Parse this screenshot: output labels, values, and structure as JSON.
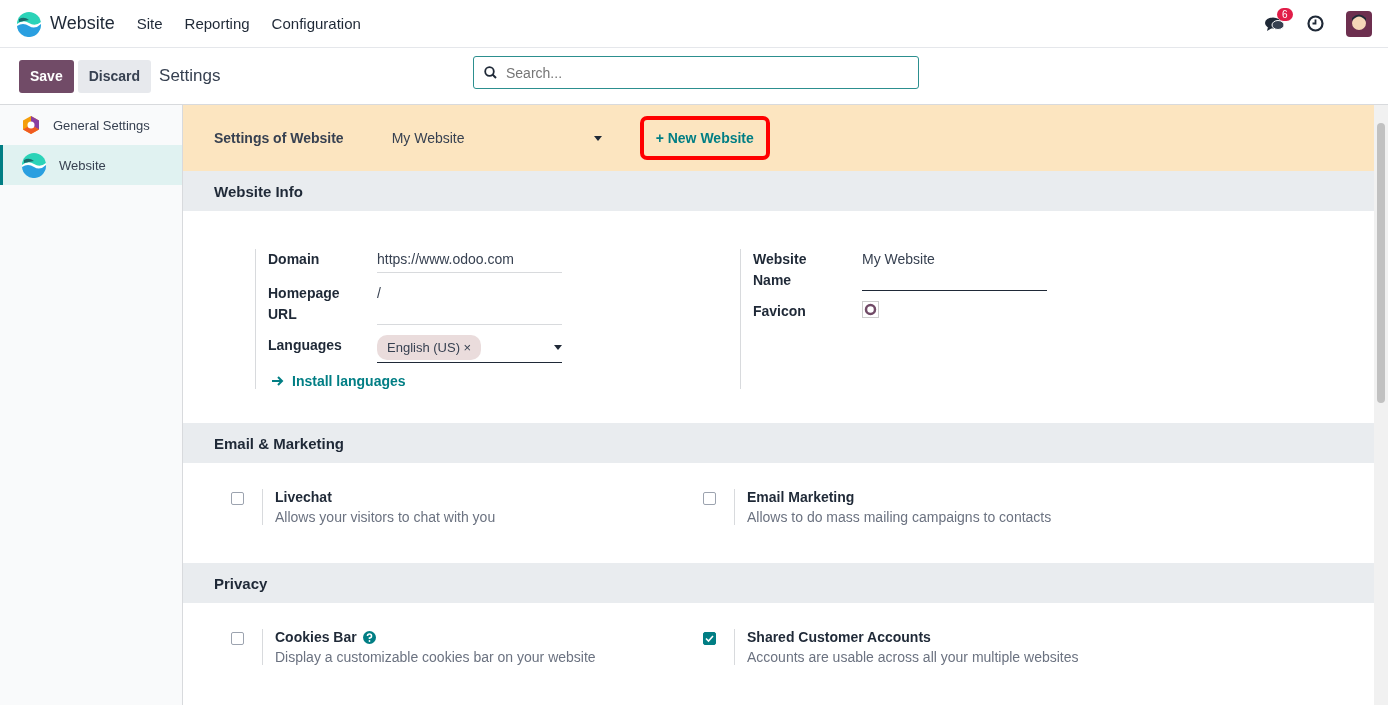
{
  "app": {
    "name": "Website"
  },
  "menu": [
    "Site",
    "Reporting",
    "Configuration"
  ],
  "systray": {
    "messages_count": "6"
  },
  "actions": {
    "save": "Save",
    "discard": "Discard"
  },
  "breadcrumb": "Settings",
  "search": {
    "placeholder": "Search..."
  },
  "sidebar": {
    "items": [
      {
        "label": "General Settings",
        "selected": false,
        "kind": "general"
      },
      {
        "label": "Website",
        "selected": true,
        "kind": "website"
      }
    ]
  },
  "website_bar": {
    "label": "Settings of Website",
    "selected_website": "My Website",
    "new_website": "+ New Website",
    "highlighted": true
  },
  "website_info": {
    "title": "Website Info",
    "left": [
      {
        "label": "Domain",
        "value": "https://www.odoo.com",
        "kind": "text"
      },
      {
        "label": "Homepage URL",
        "value": "/",
        "kind": "text"
      },
      {
        "label": "Languages",
        "tags": [
          {
            "label": "English (US)",
            "remove": "×"
          }
        ],
        "kind": "tags"
      }
    ],
    "install_link": "Install languages",
    "right": [
      {
        "label": "Website Name",
        "value": "My Website",
        "kind": "text"
      },
      {
        "label": "Favicon",
        "kind": "image"
      }
    ]
  },
  "sections": [
    {
      "title": "Email & Marketing",
      "settings": [
        {
          "title": "Livechat",
          "description": "Allows your visitors to chat with you",
          "checked": false,
          "help": false
        },
        {
          "title": "Email Marketing",
          "description": "Allows to do mass mailing campaigns to contacts",
          "checked": false,
          "help": false
        }
      ]
    },
    {
      "title": "Privacy",
      "settings": [
        {
          "title": "Cookies Bar",
          "description": "Display a customizable cookies bar on your website",
          "checked": false,
          "help": true
        },
        {
          "title": "Shared Customer Accounts",
          "description": "Accounts are usable across all your multiple websites",
          "checked": true,
          "help": false
        }
      ]
    }
  ]
}
